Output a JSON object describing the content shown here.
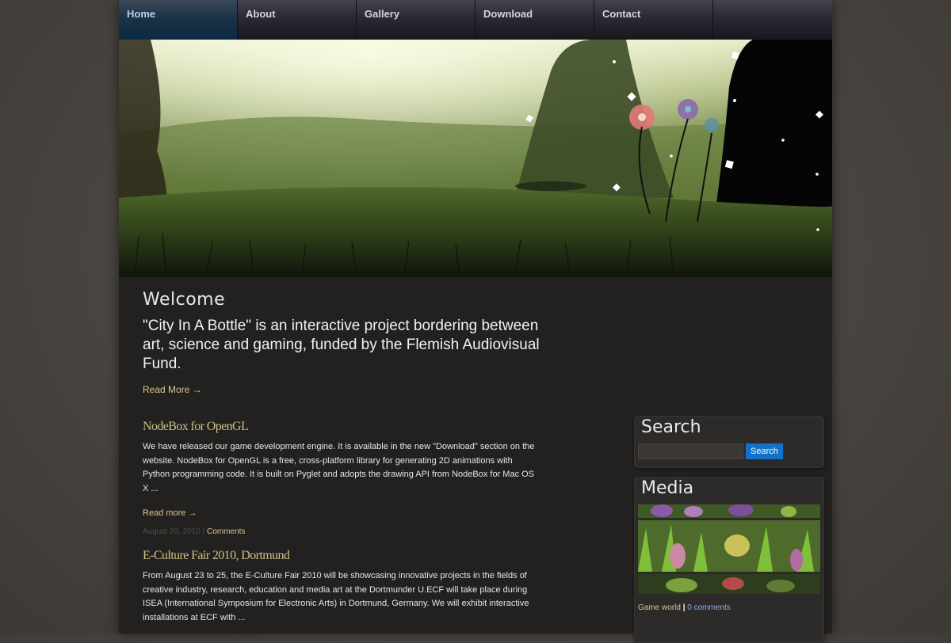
{
  "nav": {
    "items": [
      "Home",
      "About",
      "Gallery",
      "Download",
      "Contact"
    ],
    "active": "Home"
  },
  "welcome": {
    "title": "Welcome",
    "intro": "\"City In A Bottle\" is an interactive project bordering between art, science and gaming, funded by the Flemish Audiovisual Fund.",
    "read_more": "Read More →"
  },
  "posts": [
    {
      "title": "NodeBox for OpenGL",
      "body": "We have released our game development engine. It is available in the new \"Download\" section on the website. NodeBox for OpenGL is a free, cross-platform library for generating 2D animations with Python programming code. It is built on Pyglet and adopts the drawing API from NodeBox for Mac OS X ...",
      "read_more": "Read more →",
      "date": "August 20, 2010",
      "separator": "|",
      "comments": "Comments"
    },
    {
      "title": "E-Culture Fair 2010, Dortmund",
      "body": "From August 23 to 25, the E-Culture Fair 2010 will be showcasing innovative projects in the fields of creative industry, research, education and media art at the Dortmunder U.ECF will take place during ISEA (International Symposium for Electronic Arts) in Dortmund, Germany. We will exhibit interactive installations at ECF with ..."
    }
  ],
  "sidebar": {
    "search": {
      "title": "Search",
      "placeholder": "",
      "button": "Search"
    },
    "media": {
      "title": "Media",
      "category": "Game world",
      "separator": "|",
      "comments": "0 comments"
    }
  },
  "colors": {
    "nav_active": "#0b2a44",
    "link_gold": "#d8c48c",
    "search_button": "#1271c8"
  }
}
